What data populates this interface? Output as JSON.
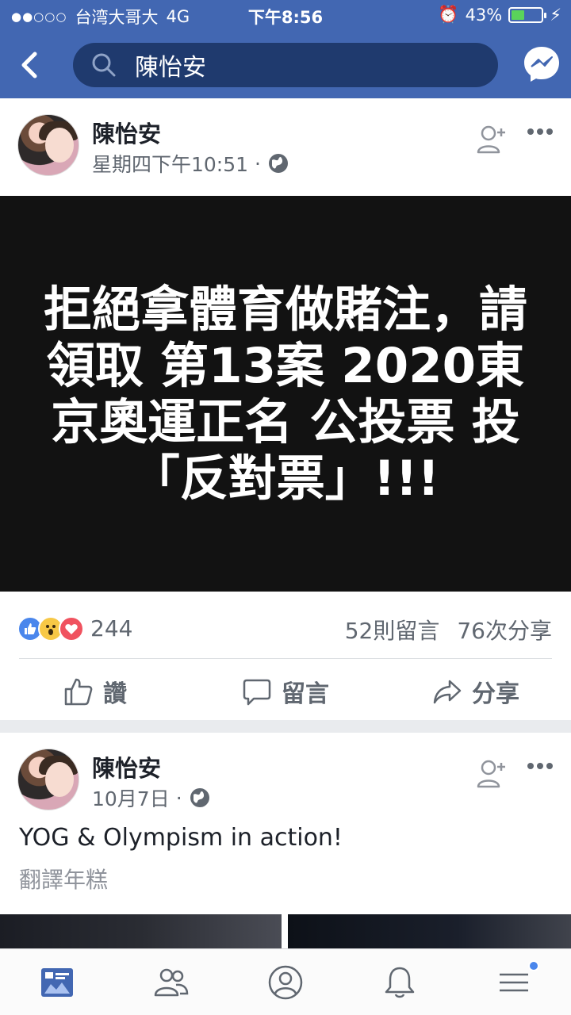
{
  "status_bar": {
    "carrier": "台湾大哥大",
    "network": "4G",
    "time": "下午8:56",
    "battery_pct": "43%",
    "battery_level": 0.43
  },
  "header": {
    "search_text": "陳怡安"
  },
  "posts": [
    {
      "author": "陳怡安",
      "timestamp": "星期四下午10:51",
      "separator": "·",
      "image_text": "拒絕拿體育做賭注，請領取 第13案 2020東京奧運正名 公投票 投「反對票」!!!",
      "reaction_count": "244",
      "comments": "52則留言",
      "shares": "76次分享",
      "actions": {
        "like": "讚",
        "comment": "留言",
        "share": "分享"
      }
    },
    {
      "author": "陳怡安",
      "timestamp": "10月7日",
      "separator": "·",
      "text": "YOG & Olympism in action!",
      "translate": "翻譯年糕"
    }
  ],
  "colors": {
    "brand": "#4267b2",
    "secondary_text": "#606770"
  },
  "icons": [
    "back-icon",
    "search-icon",
    "messenger-icon",
    "globe-icon",
    "add-friend-icon",
    "more-icon",
    "like-icon",
    "comment-icon",
    "share-icon",
    "news-feed-icon",
    "friends-icon",
    "profile-icon",
    "notifications-icon",
    "menu-icon"
  ]
}
